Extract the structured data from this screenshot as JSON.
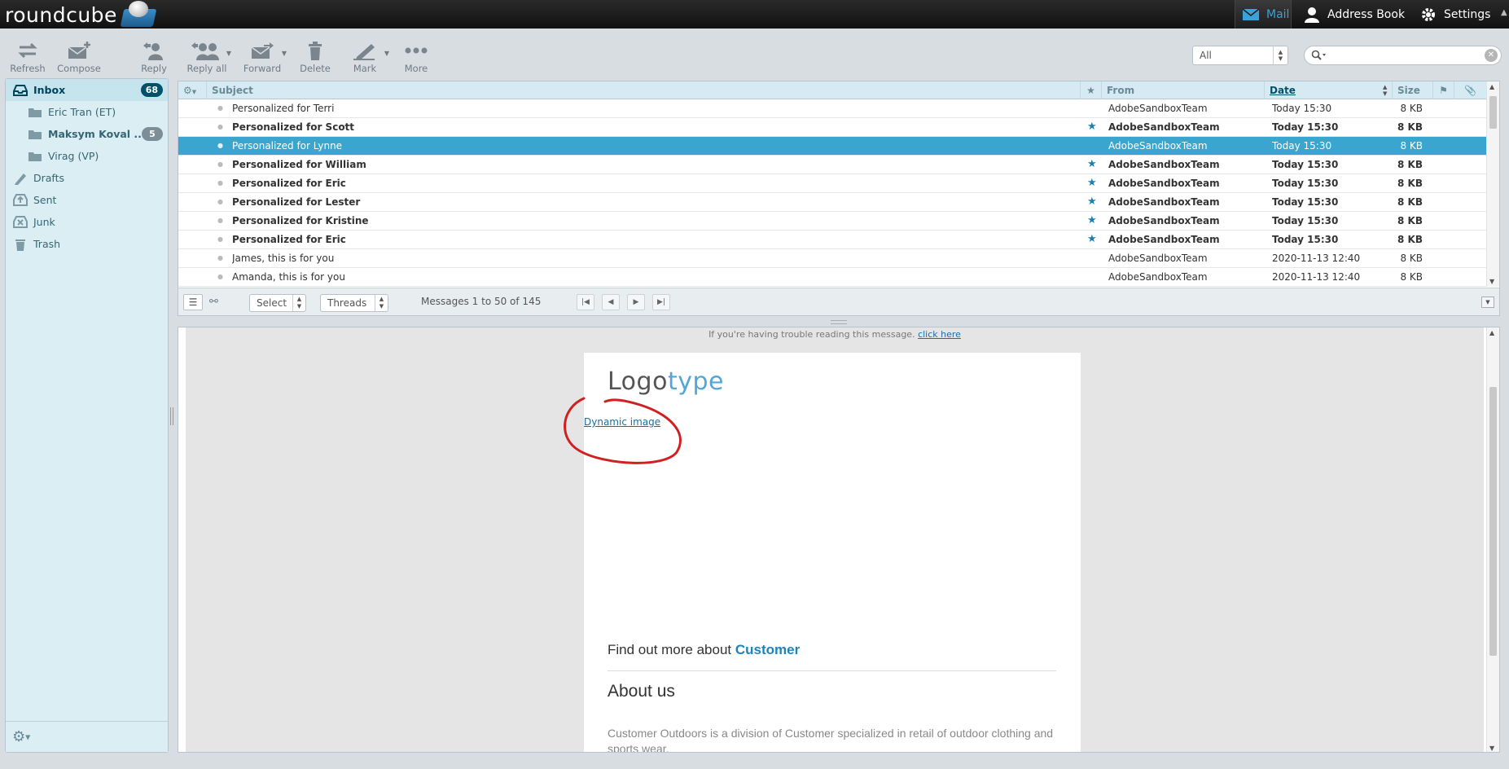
{
  "app": {
    "logo_text": "roundcube",
    "nav": {
      "mail": "Mail",
      "address_book": "Address Book",
      "settings": "Settings"
    }
  },
  "colors": {
    "accent": "#3aa6cf",
    "count_badge": "#00526a",
    "star": "#1a7fb4",
    "brand_link": "#1a84bd"
  },
  "toolbar": {
    "refresh": "Refresh",
    "compose": "Compose",
    "reply": "Reply",
    "reply_all": "Reply all",
    "forward": "Forward",
    "delete": "Delete",
    "mark": "Mark",
    "more": "More"
  },
  "filter": {
    "selected": "All"
  },
  "search": {
    "placeholder": ""
  },
  "folders": [
    {
      "name": "Inbox",
      "count": "68",
      "icon": "inbox-icon"
    },
    {
      "name": "Eric Tran (ET)",
      "icon": "folder-icon"
    },
    {
      "name": "Maksym Koval ...",
      "count": "5",
      "icon": "folder-icon"
    },
    {
      "name": "Virag (VP)",
      "icon": "folder-icon"
    },
    {
      "name": "Drafts",
      "icon": "pencil-icon"
    },
    {
      "name": "Sent",
      "icon": "sent-icon"
    },
    {
      "name": "Junk",
      "icon": "junk-icon"
    },
    {
      "name": "Trash",
      "icon": "trash-icon"
    }
  ],
  "list": {
    "headers": {
      "subject": "Subject",
      "from": "From",
      "date": "Date",
      "size": "Size"
    },
    "rows": [
      {
        "subject": "Personalized for Terri",
        "from": "AdobeSandboxTeam",
        "date": "Today 15:30",
        "size": "8 KB",
        "unread": false,
        "flagged": false
      },
      {
        "subject": "Personalized for Scott",
        "from": "AdobeSandboxTeam",
        "date": "Today 15:30",
        "size": "8 KB",
        "unread": true,
        "flagged": true
      },
      {
        "subject": "Personalized for Lynne",
        "from": "AdobeSandboxTeam",
        "date": "Today 15:30",
        "size": "8 KB",
        "unread": false,
        "flagged": false,
        "selected": true
      },
      {
        "subject": "Personalized for William",
        "from": "AdobeSandboxTeam",
        "date": "Today 15:30",
        "size": "8 KB",
        "unread": true,
        "flagged": true
      },
      {
        "subject": "Personalized for Eric",
        "from": "AdobeSandboxTeam",
        "date": "Today 15:30",
        "size": "8 KB",
        "unread": true,
        "flagged": true
      },
      {
        "subject": "Personalized for Lester",
        "from": "AdobeSandboxTeam",
        "date": "Today 15:30",
        "size": "8 KB",
        "unread": true,
        "flagged": true
      },
      {
        "subject": "Personalized for Kristine",
        "from": "AdobeSandboxTeam",
        "date": "Today 15:30",
        "size": "8 KB",
        "unread": true,
        "flagged": true
      },
      {
        "subject": "Personalized for Eric",
        "from": "AdobeSandboxTeam",
        "date": "Today 15:30",
        "size": "8 KB",
        "unread": true,
        "flagged": true
      },
      {
        "subject": "James, this is for you",
        "from": "AdobeSandboxTeam",
        "date": "2020-11-13 12:40",
        "size": "8 KB",
        "unread": false,
        "flagged": false
      },
      {
        "subject": "Amanda, this is for you",
        "from": "AdobeSandboxTeam",
        "date": "2020-11-13 12:40",
        "size": "8 KB",
        "unread": false,
        "flagged": false
      }
    ],
    "footer": {
      "select": "Select",
      "threads": "Threads",
      "count_text": "Messages 1 to 50 of 145"
    }
  },
  "preview": {
    "trouble_text": "If you're having trouble reading this message.",
    "trouble_link": "click here",
    "logo_part1": "Logo",
    "logo_part2": "type",
    "dynamic_image": "Dynamic image",
    "find_out": "Find out more about ",
    "find_out_brand": "Customer",
    "about_title": "About us",
    "about_text": "Customer Outdoors is a division of Customer specialized in retail of outdoor clothing and sports wear."
  }
}
